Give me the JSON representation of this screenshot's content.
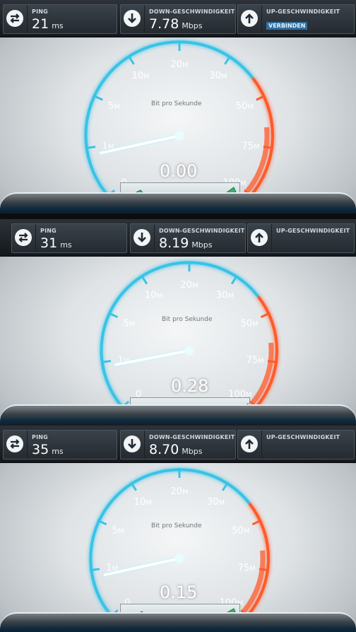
{
  "panels": [
    {
      "ping": {
        "label": "PING",
        "value": "21",
        "unit": "ms"
      },
      "down": {
        "label": "DOWN-GESCHWINDIGKEIT",
        "value": "7.78",
        "unit": "Mbps"
      },
      "up": {
        "label": "UP-GESCHWINDIGKEIT",
        "badge": "VERBINDEN"
      },
      "gauge": {
        "reading": "0.00",
        "subtitle": "Bit pro Sekunde",
        "needle_value": 0.85
      }
    },
    {
      "ping": {
        "label": "PING",
        "value": "31",
        "unit": "ms"
      },
      "down": {
        "label": "DOWN-GESCHWINDIGKEIT",
        "value": "8.19",
        "unit": "Mbps"
      },
      "up": {
        "label": "UP-GESCHWINDIGKEIT"
      },
      "gauge": {
        "reading": "0.28",
        "subtitle": "Bit pro Sekunde",
        "needle_value": 0.9
      }
    },
    {
      "ping": {
        "label": "PING",
        "value": "35",
        "unit": "ms"
      },
      "down": {
        "label": "DOWN-GESCHWINDIGKEIT",
        "value": "8.70",
        "unit": "Mbps"
      },
      "up": {
        "label": "UP-GESCHWINDIGKEIT"
      },
      "gauge": {
        "reading": "0.15",
        "subtitle": "Bit pro Sekunde",
        "needle_value": 0.85
      }
    }
  ],
  "scale_labels": [
    {
      "num": "0",
      "unit": ""
    },
    {
      "num": "1",
      "unit": "M"
    },
    {
      "num": "5",
      "unit": "M"
    },
    {
      "num": "10",
      "unit": "M"
    },
    {
      "num": "20",
      "unit": "M"
    },
    {
      "num": "30",
      "unit": "M"
    },
    {
      "num": "50",
      "unit": "M"
    },
    {
      "num": "75",
      "unit": "M"
    },
    {
      "num": "100",
      "unit": "M"
    }
  ],
  "colors": {
    "arc_blue": "#39c3e6",
    "arc_red": "#ff5a2a",
    "needle": "#ffffff",
    "graph_fill": "#36b36a"
  },
  "icons": {
    "ping": "ping-arrows-icon",
    "down": "download-arrow-icon",
    "up": "upload-arrow-icon"
  }
}
